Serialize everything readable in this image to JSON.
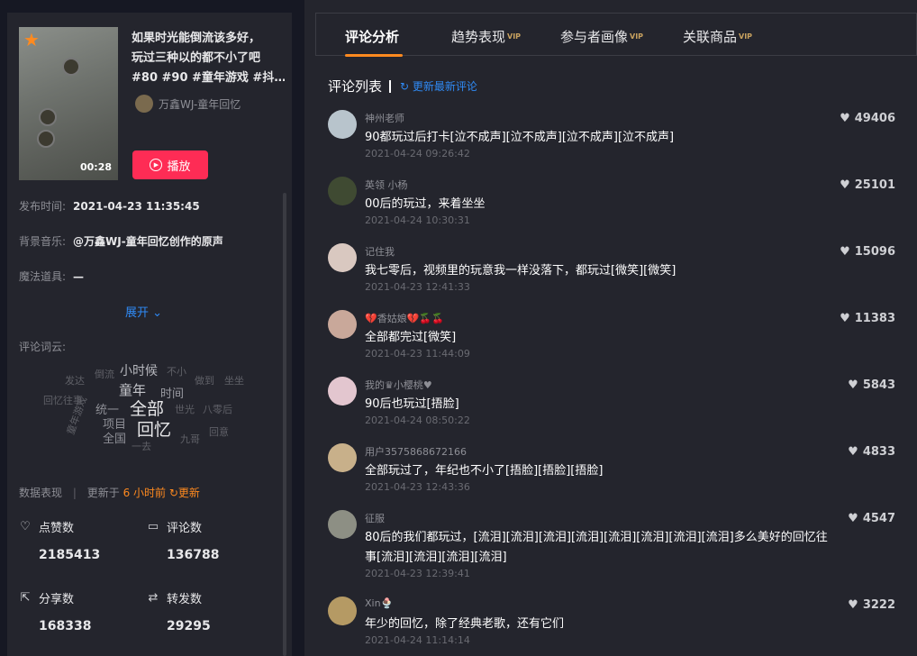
{
  "video": {
    "title_lines": [
      "如果时光能倒流该多好，",
      "玩过三种以的都不小了吧",
      "#80 #90 #童年游戏 #抖…"
    ],
    "author": "万鑫WJ-童年回忆",
    "duration": "00:28",
    "play_label": "播放"
  },
  "meta": {
    "publish_label": "发布时间:",
    "publish_value": "2021-04-23 11:35:45",
    "music_label": "背景音乐:",
    "music_value": "@万鑫WJ-童年回忆创作的原声",
    "prop_label": "魔法道具:",
    "prop_value": "—",
    "expand_label": "展开 ⌄",
    "cloud_label": "评论词云:"
  },
  "word_cloud": [
    {
      "text": "小时候",
      "weight": 3,
      "color": "#b5b6bc"
    },
    {
      "text": "童年",
      "weight": 4,
      "color": "#c4c5ca"
    },
    {
      "text": "时间",
      "weight": 3,
      "color": "#9a9ba2"
    },
    {
      "text": "全部",
      "weight": 5,
      "color": "#e8e8ea"
    },
    {
      "text": "回忆",
      "weight": 5,
      "color": "#e8e8ea"
    },
    {
      "text": "统一",
      "weight": 2,
      "color": "#8e8f96"
    },
    {
      "text": "项目",
      "weight": 2,
      "color": "#8e8f96"
    },
    {
      "text": "全国",
      "weight": 2,
      "color": "#8e8f96"
    },
    {
      "text": "发达",
      "weight": 1,
      "color": "#5f6067"
    },
    {
      "text": "倒流",
      "weight": 1,
      "color": "#5f6067"
    },
    {
      "text": "不小",
      "weight": 1,
      "color": "#5f6067"
    },
    {
      "text": "做到",
      "weight": 1,
      "color": "#5f6067"
    },
    {
      "text": "坐坐",
      "weight": 1,
      "color": "#5f6067"
    },
    {
      "text": "回忆往事",
      "weight": 1,
      "color": "#5f6067"
    },
    {
      "text": "世光",
      "weight": 1,
      "color": "#5f6067"
    },
    {
      "text": "八零后",
      "weight": 1,
      "color": "#5f6067"
    },
    {
      "text": "回意",
      "weight": 1,
      "color": "#5f6067"
    },
    {
      "text": "九哥",
      "weight": 1,
      "color": "#5f6067"
    },
    {
      "text": "一去",
      "weight": 1,
      "color": "#5f6067"
    },
    {
      "text": "童年游戏",
      "weight": 1,
      "color": "#5f6067"
    }
  ],
  "stats": {
    "header_label": "数据表现",
    "updated_prefix": "更新于",
    "updated_value": "6 小时前",
    "refresh_label": "更新",
    "likes_label": "点赞数",
    "likes_value": "2185413",
    "comments_label": "评论数",
    "comments_value": "136788",
    "shares_label": "分享数",
    "shares_value": "168338",
    "forwards_label": "转发数",
    "forwards_value": "29295"
  },
  "tabs": [
    {
      "label": "评论分析",
      "vip": false,
      "active": true
    },
    {
      "label": "趋势表现",
      "vip": true,
      "active": false
    },
    {
      "label": "参与者画像",
      "vip": true,
      "active": false
    },
    {
      "label": "关联商品",
      "vip": true,
      "active": false
    }
  ],
  "vip_badge": "VIP",
  "comments_list": {
    "title": "评论列表",
    "refresh_label": "更新最新评论"
  },
  "comments": [
    {
      "user": "神州老师",
      "text": "90都玩过后打卡[泣不成声][泣不成声][泣不成声][泣不成声]",
      "time": "2021-04-24 09:26:42",
      "likes": "49406",
      "avatar_color": "#b8c4cc"
    },
    {
      "user": "英领 小杨",
      "text": "00后的玩过，来着坐坐",
      "time": "2021-04-24 10:30:31",
      "likes": "25101",
      "avatar_color": "#3f4a32"
    },
    {
      "user": "记住我",
      "text": "我七零后，视频里的玩意我一样没落下，都玩过[微笑][微笑]",
      "time": "2021-04-23 12:41:33",
      "likes": "15096",
      "avatar_color": "#d9c8c0"
    },
    {
      "user": "💔香姑娘💔🍒🍒",
      "text": "全部都完过[微笑]",
      "time": "2021-04-23 11:44:09",
      "likes": "11383",
      "avatar_color": "#c9a89a"
    },
    {
      "user": "我的♛小樱桃♥",
      "text": "90后也玩过[捂脸]",
      "time": "2021-04-24 08:50:22",
      "likes": "5843",
      "avatar_color": "#e3c6cf"
    },
    {
      "user": "用户3575868672166",
      "text": "全部玩过了，年纪也不小了[捂脸][捂脸][捂脸]",
      "time": "2021-04-23 12:43:36",
      "likes": "4833",
      "avatar_color": "#c8b08a"
    },
    {
      "user": "征服",
      "text": "80后的我们都玩过，[流泪][流泪][流泪][流泪][流泪][流泪][流泪][流泪]多么美好的回忆往事[流泪][流泪][流泪][流泪]",
      "time": "2021-04-23 12:39:41",
      "likes": "4547",
      "avatar_color": "#8d8f84"
    },
    {
      "user": "Xin🍨",
      "text": "年少的回忆，除了经典老歌，还有它们",
      "time": "2021-04-24 11:14:14",
      "likes": "3222",
      "avatar_color": "#b59a64"
    }
  ]
}
